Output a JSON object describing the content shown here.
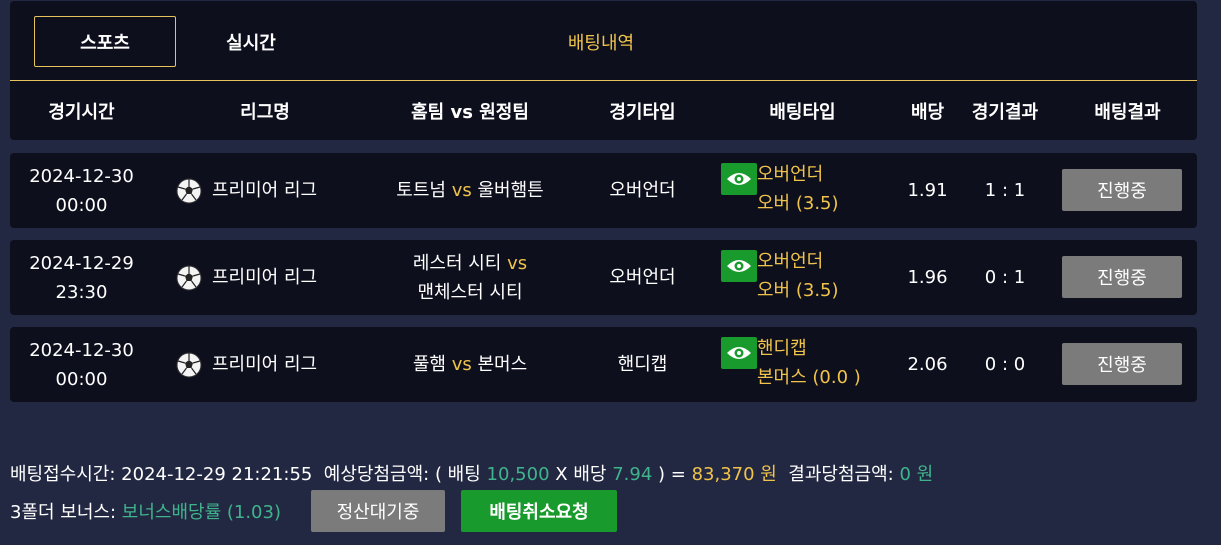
{
  "tabs": [
    {
      "label": "스포츠"
    },
    {
      "label": "실시간"
    },
    {
      "label": "배팅내역"
    }
  ],
  "columns": [
    "경기시간",
    "리그명",
    "홈팀 vs 원정팀",
    "경기타입",
    "배팅타입",
    "배당",
    "경기결과",
    "배팅결과"
  ],
  "rows": [
    {
      "date": "2024-12-30",
      "time": "00:00",
      "league": "프리미어 리그",
      "home": "토트넘",
      "vs": "vs",
      "away": "울버햄튼",
      "game_type": "오버언더",
      "bet_type": "오버언더",
      "bet_pick": "오버 (3.5)",
      "odds": "1.91",
      "result": "1 : 1",
      "status": "진행중"
    },
    {
      "date": "2024-12-29",
      "time": "23:30",
      "league": "프리미어 리그",
      "home": "레스터 시티",
      "vs": "vs",
      "away": "맨체스터 시티",
      "game_type": "오버언더",
      "bet_type": "오버언더",
      "bet_pick": "오버 (3.5)",
      "odds": "1.96",
      "result": "0 : 1",
      "status": "진행중"
    },
    {
      "date": "2024-12-30",
      "time": "00:00",
      "league": "프리미어 리그",
      "home": "풀햄",
      "vs": "vs",
      "away": "본머스",
      "game_type": "핸디캡",
      "bet_type": "핸디캡",
      "bet_pick": "본머스 (0.0 )",
      "odds": "2.06",
      "result": "0 : 0",
      "status": "진행중"
    }
  ],
  "footer": {
    "received_label": "배팅접수시간:",
    "received_value": "2024-12-29 21:21:55",
    "expected_label": "예상당첨금액: ( 배팅",
    "bet_amount": "10,500",
    "x_label": "X 배당",
    "total_odds": "7.94",
    "close_eq": ") =",
    "expected_amount": "83,370",
    "won1": "원",
    "result_label": "결과당첨금액:",
    "result_amount": "0",
    "won2": "원",
    "bonus_label": "3폴더 보너스:",
    "bonus_value": "보너스배당률 (1.03)",
    "settle_button": "정산대기중",
    "cancel_button": "배팅취소요청"
  },
  "colors": {
    "gold": "#f0c34a",
    "green": "#3fb48c",
    "button_green": "#189a2d",
    "button_gray": "#7b7b7b"
  },
  "icons": {
    "eye": "eye-icon",
    "ball": "soccer-ball-icon"
  }
}
